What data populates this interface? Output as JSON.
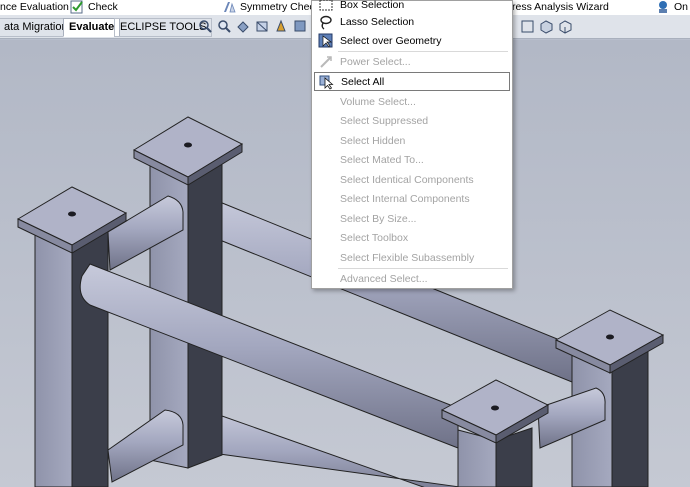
{
  "ribbon": {
    "tools": [
      {
        "label": "nce Evaluation",
        "icon": "evaluation-icon"
      },
      {
        "label": "Check",
        "icon": "check-icon"
      },
      {
        "label": "Symmetry Check",
        "icon": "symmetry-check-icon"
      },
      {
        "label": "ress Analysis Wizard",
        "icon": "stress-analysis-icon"
      },
      {
        "label": "On",
        "icon": "on-icon"
      }
    ]
  },
  "tabs": [
    {
      "label": "ata Migration",
      "active": false
    },
    {
      "label": "Evaluate",
      "active": true
    },
    {
      "label": "ECLIPSE TOOLS",
      "active": false
    }
  ],
  "menu": {
    "items": [
      {
        "label": "Box Selection",
        "icon": "box-selection-icon",
        "enabled": true
      },
      {
        "label": "Lasso Selection",
        "icon": "lasso-selection-icon",
        "enabled": true
      },
      {
        "label": "Select over Geometry",
        "icon": "select-over-geometry-icon",
        "enabled": true
      },
      {
        "label": "Power Select...",
        "icon": "power-select-icon",
        "enabled": false
      },
      {
        "label": "Select All",
        "icon": "select-all-icon",
        "enabled": true,
        "highlighted": true
      },
      {
        "label": "Volume Select...",
        "enabled": false
      },
      {
        "label": "Select Suppressed",
        "enabled": false
      },
      {
        "label": "Select Hidden",
        "enabled": false
      },
      {
        "label": "Select Mated To...",
        "enabled": false
      },
      {
        "label": "Select Identical Components",
        "enabled": false
      },
      {
        "label": "Select Internal Components",
        "enabled": false
      },
      {
        "label": "Select By Size...",
        "enabled": false
      },
      {
        "label": "Select Toolbox",
        "enabled": false
      },
      {
        "label": "Select Flexible Subassembly",
        "enabled": false
      },
      {
        "label": "Advanced Select...",
        "enabled": false
      }
    ]
  },
  "colors": {
    "viewport_bg": "#b9bfcd",
    "part_face": "#a9adc6",
    "part_dark": "#3b3e4a"
  }
}
